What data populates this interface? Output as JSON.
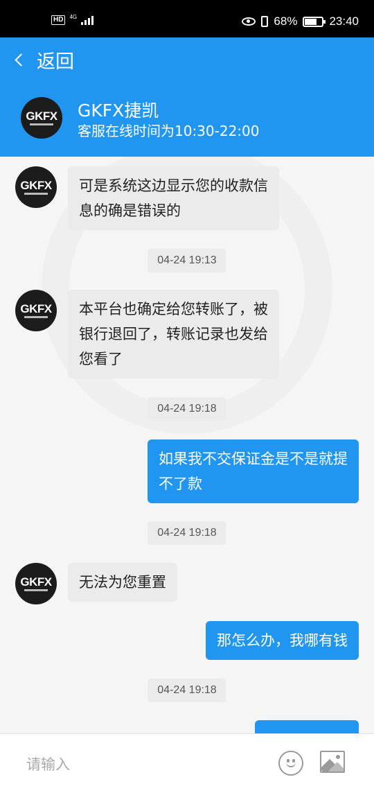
{
  "status_bar": {
    "hd_badge": "HD",
    "network": "4G",
    "battery_percent": "68%",
    "time": "23:40"
  },
  "nav": {
    "back_label": "返回"
  },
  "agent": {
    "logo_text": "GKFX",
    "name": "GKFX捷凯",
    "hours": "客服在线时间为10:30-22:00"
  },
  "messages": [
    {
      "side": "incoming",
      "text_lines": [
        "可是系统这边显示您的收款信",
        "息的确是错误的"
      ]
    },
    {
      "timestamp": "04-24 19:13"
    },
    {
      "side": "incoming",
      "text_lines": [
        "本平台也确定给您转账了，被",
        "银行退回了，转账记录也发给",
        "您看了"
      ]
    },
    {
      "timestamp": "04-24 19:18"
    },
    {
      "side": "outgoing",
      "text_lines": [
        "如果我不交保证金是不是就提",
        "不了款"
      ]
    },
    {
      "timestamp": "04-24 19:18"
    },
    {
      "side": "incoming",
      "text_lines": [
        "无法为您重置"
      ]
    },
    {
      "side": "outgoing",
      "text_lines": [
        "那怎么办，我哪有钱"
      ]
    },
    {
      "timestamp": "04-24 19:18"
    },
    {
      "side": "outgoing",
      "text_lines": [
        ""
      ]
    }
  ],
  "input": {
    "placeholder": "请输入",
    "value": ""
  },
  "icons": {
    "emoji": "emoji-icon",
    "image": "image-icon",
    "back": "back-chevron-icon"
  },
  "colors": {
    "accent": "#2196f0",
    "incoming_bubble": "#ebebeb",
    "background": "#f5f5f5"
  }
}
